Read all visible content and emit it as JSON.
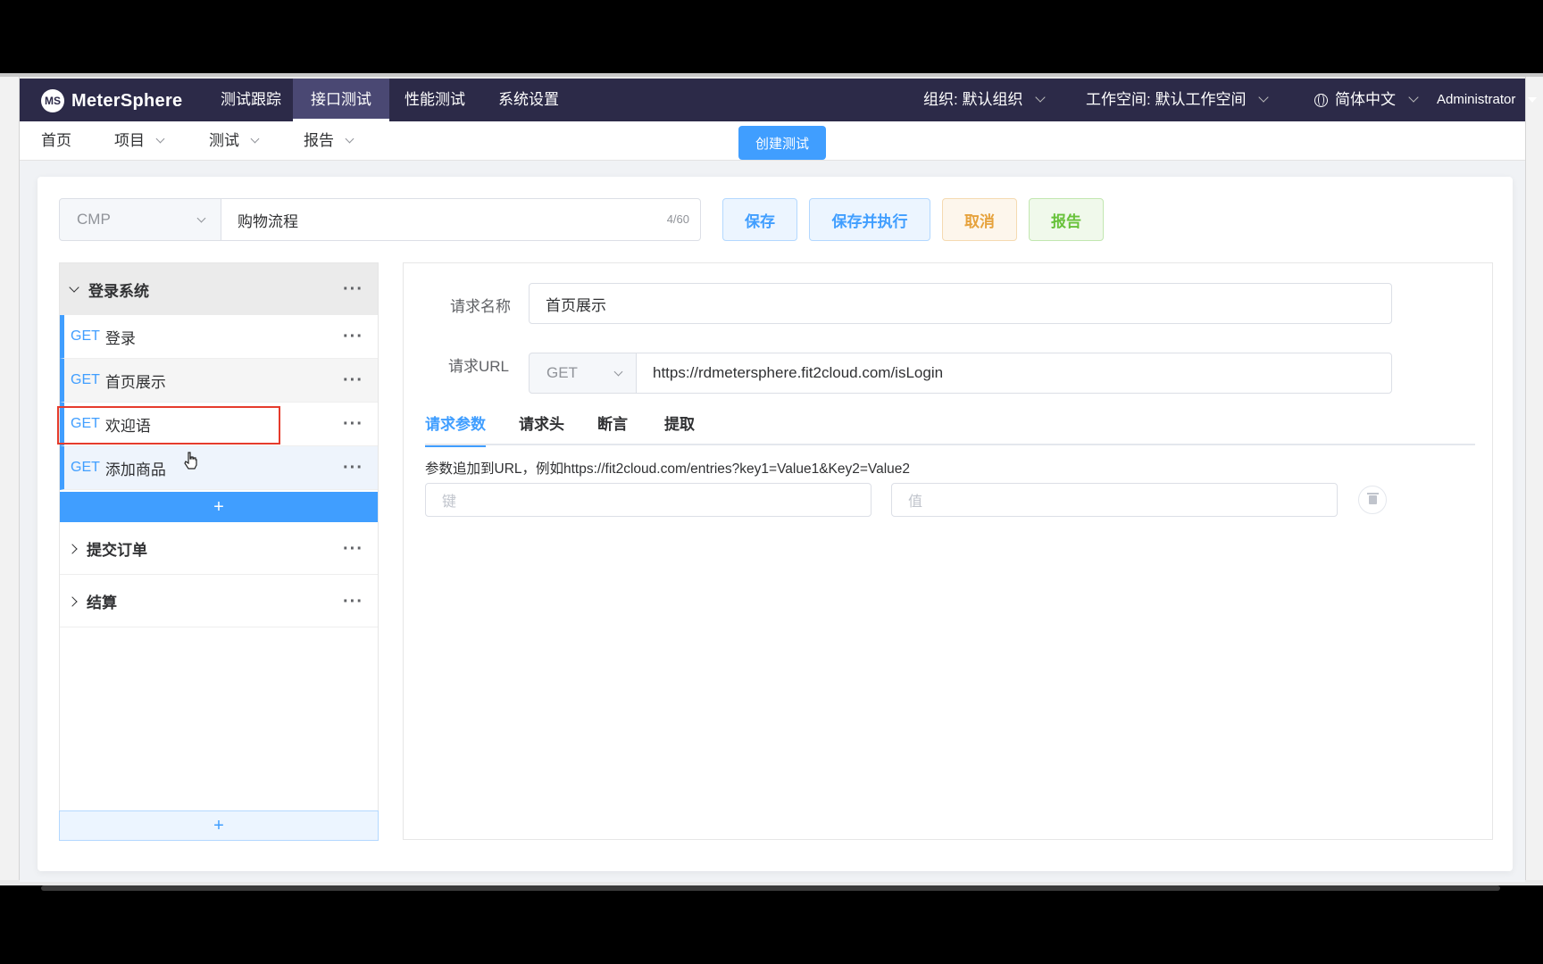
{
  "topnav": {
    "logo": "MeterSphere",
    "logo_mark": "MS",
    "items": [
      "测试跟踪",
      "接口测试",
      "性能测试",
      "系统设置"
    ],
    "active": "接口测试",
    "org": "组织: 默认组织",
    "workspace": "工作空间: 默认工作空间",
    "language": "简体中文",
    "user": "Administrator"
  },
  "subnav": {
    "home": "首页",
    "project": "项目",
    "test": "测试",
    "report": "报告",
    "create_button": "创建测试"
  },
  "toolbar": {
    "project_select": "CMP",
    "test_name": "购物流程",
    "name_counter": "4/60",
    "save": "保存",
    "save_run": "保存并执行",
    "cancel": "取消",
    "report": "报告"
  },
  "scenarios": {
    "expanded": {
      "name": "登录系统",
      "requests": [
        {
          "method": "GET",
          "name": "登录"
        },
        {
          "method": "GET",
          "name": "首页展示"
        },
        {
          "method": "GET",
          "name": "欢迎语"
        },
        {
          "method": "GET",
          "name": "添加商品"
        }
      ],
      "add_label": "+"
    },
    "collapsed": [
      "提交订单",
      "结算"
    ],
    "add_scenario_label": "+",
    "more_icon": "···"
  },
  "request_detail": {
    "name_label": "请求名称",
    "name_value": "首页展示",
    "url_label": "请求URL",
    "method": "GET",
    "url": "https://rdmetersphere.fit2cloud.com/isLogin",
    "tabs": [
      "请求参数",
      "请求头",
      "断言",
      "提取"
    ],
    "active_tab": "请求参数",
    "hint": "参数追加到URL，例如https://fit2cloud.com/entries?key1=Value1&Key2=Value2",
    "key_placeholder": "键",
    "value_placeholder": "值"
  },
  "colors": {
    "nav_bg": "#2c2a48",
    "primary": "#409eff",
    "warning": "#e6a23c",
    "success": "#67c23a",
    "highlight": "#e53b2c"
  }
}
